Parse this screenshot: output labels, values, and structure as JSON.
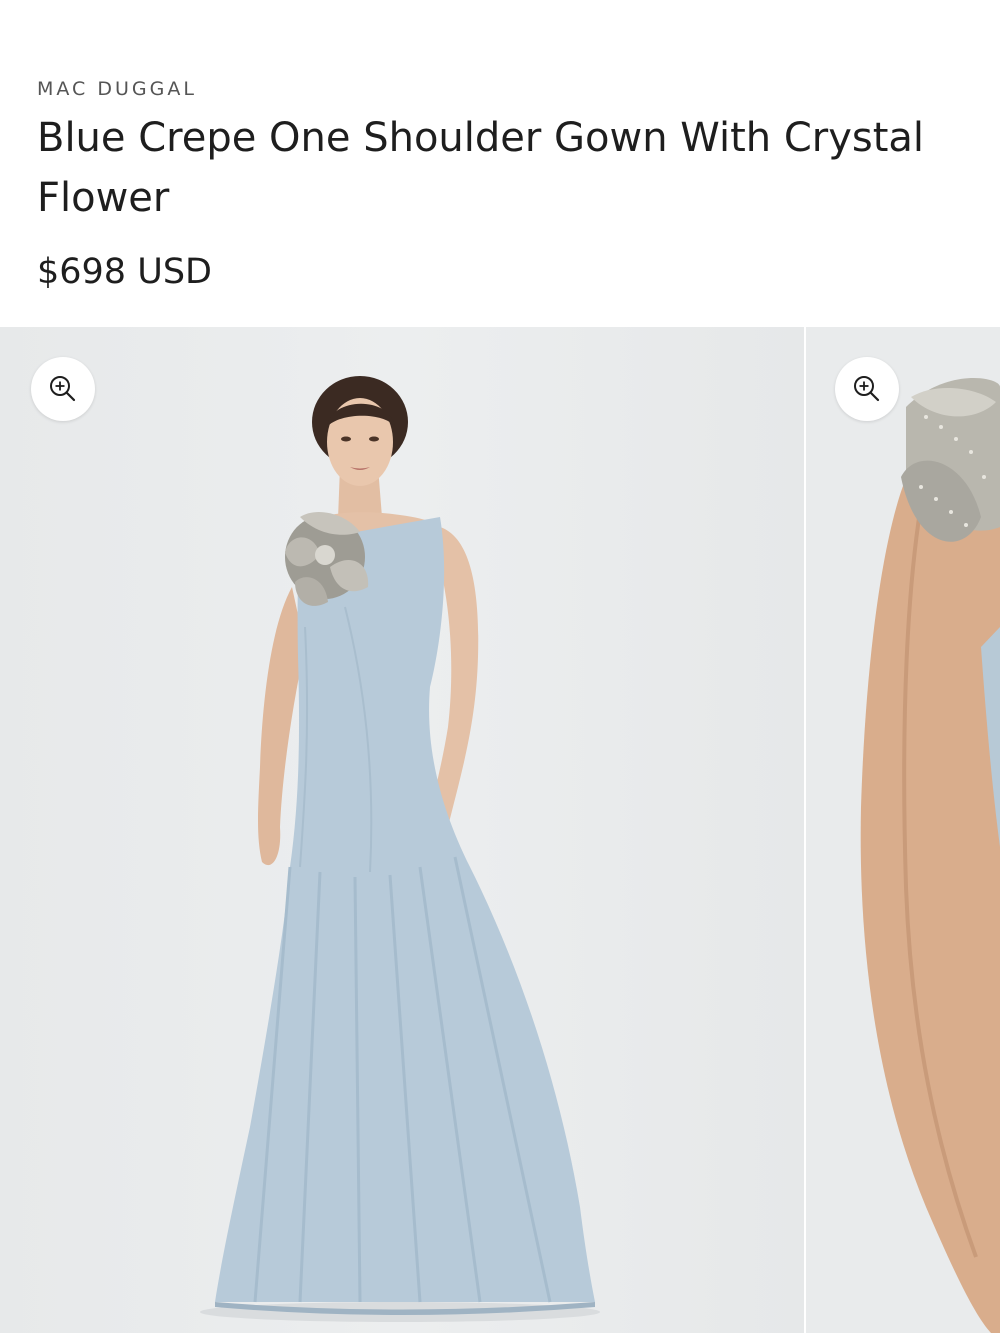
{
  "product": {
    "vendor": "MAC DUGGAL",
    "title": "Blue Crepe One Shoulder Gown With Crystal Flower",
    "price": "$698 USD"
  },
  "gallery": {
    "slides": [
      {
        "image": "model-full-length-photo",
        "zoom_icon": "zoom-in-icon"
      },
      {
        "image": "crystal-flower-detail-photo",
        "zoom_icon": "zoom-in-icon"
      }
    ]
  },
  "colors": {
    "dress_blue": "#b5c8d8",
    "background": "#e9ebec",
    "text": "#1e1e1e",
    "vendor_text": "#555555"
  }
}
